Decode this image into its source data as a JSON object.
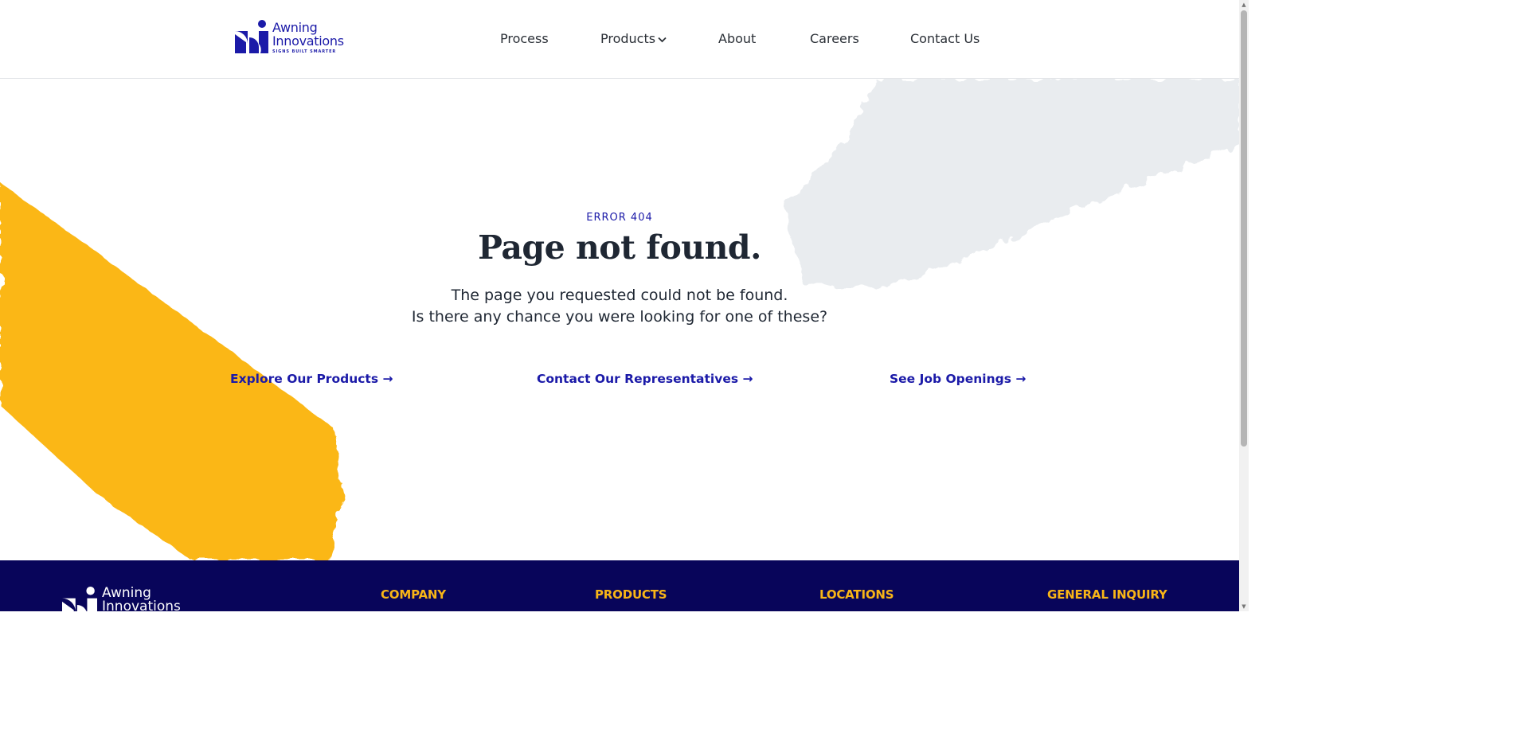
{
  "colors": {
    "brand_blue": "#1b1aa8",
    "accent_yellow": "#fbb718",
    "footer_bg": "#08055a",
    "text_dark": "#1f2733"
  },
  "header": {
    "logo": {
      "line1": "Awning",
      "line2": "Innovations",
      "tagline": "SIGNS BUILT SMARTER"
    },
    "nav": [
      {
        "label": "Process"
      },
      {
        "label": "Products",
        "icon": "chevron-down-icon"
      },
      {
        "label": "About"
      },
      {
        "label": "Careers"
      },
      {
        "label": "Contact Us"
      }
    ]
  },
  "error": {
    "eyebrow": "ERROR 404",
    "title": "Page not found.",
    "line1": "The page you requested could not be found.",
    "line2": "Is there any chance you were looking for one of these?"
  },
  "links": [
    {
      "label": "Explore Our Products →"
    },
    {
      "label": "Contact Our Representatives →"
    },
    {
      "label": "See Job Openings →"
    }
  ],
  "footer": {
    "logo": {
      "line1": "Awning",
      "line2": "Innovations"
    },
    "headings": [
      "COMPANY",
      "PRODUCTS",
      "LOCATIONS",
      "GENERAL INQUIRY"
    ]
  }
}
